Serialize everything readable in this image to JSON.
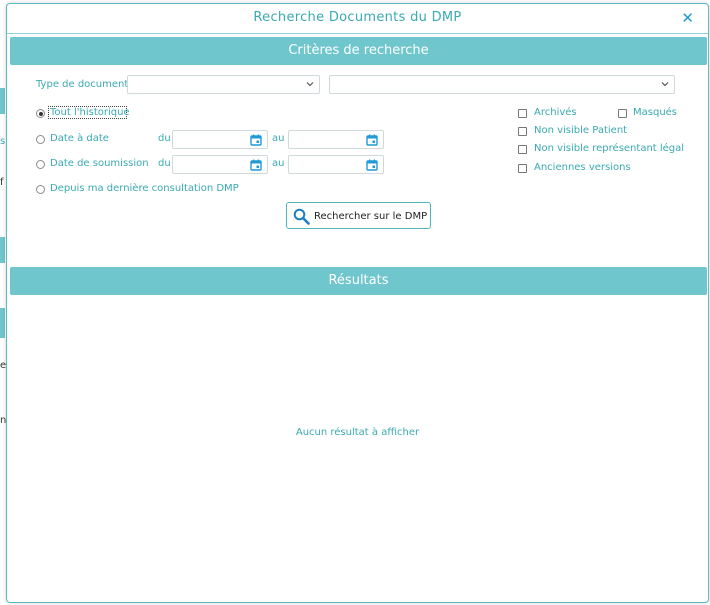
{
  "modal": {
    "title": "Recherche Documents du DMP",
    "close_icon": "close-icon"
  },
  "criteria": {
    "header": "Critères de recherche",
    "doc_type_label": "Type de document",
    "doc_type_value": "",
    "doc_subtype_value": "",
    "period_options": [
      {
        "label": "Tout l'historique",
        "checked": true
      },
      {
        "label": "Date à date",
        "checked": false
      },
      {
        "label": "Date de soumission",
        "checked": false
      },
      {
        "label": "Depuis ma dernière consultation DMP",
        "checked": false
      }
    ],
    "from_label": "du",
    "to_label": "au",
    "date_from_1": "",
    "date_to_1": "",
    "date_from_2": "",
    "date_to_2": "",
    "filters": {
      "archived": {
        "label": "Archivés",
        "checked": false
      },
      "hidden": {
        "label": "Masqués",
        "checked": false
      },
      "not_visible_patient": {
        "label": "Non visible Patient",
        "checked": false
      },
      "not_visible_legal_rep": {
        "label": "Non visible représentant légal",
        "checked": false
      },
      "old_versions": {
        "label": "Anciennes versions",
        "checked": false
      }
    },
    "search_button": "Rechercher sur le DMP"
  },
  "results": {
    "header": "Résultats",
    "empty_message": "Aucun résultat à afficher"
  },
  "colors": {
    "accent": "#6fc6cc",
    "text_accent": "#3aaab2",
    "close": "#1f9ad6",
    "calendar": "#1f9ad6"
  }
}
